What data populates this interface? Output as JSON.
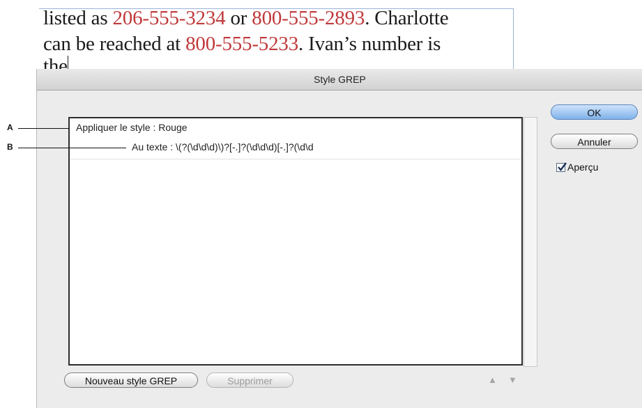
{
  "document": {
    "line1_a": "listed as ",
    "line1_phone1": "206-555-3234",
    "line1_b": " or ",
    "line1_phone2": "800-555-2893",
    "line1_c": ". Charlotte",
    "line2_a": "can be reached at ",
    "line2_phone": "800-555-5233",
    "line2_b": ". Ivan’s number is",
    "line3": "the"
  },
  "dialog": {
    "title": "Style GREP",
    "rule": {
      "apply_style": "Appliquer le style : Rouge",
      "to_text": "Au texte : \\(?(\\d\\d\\d)\\)?[-.]?(\\d\\d\\d)[-.]?(\\d\\d"
    },
    "buttons": {
      "ok": "OK",
      "cancel": "Annuler",
      "new_grep_style": "Nouveau style GREP",
      "delete": "Supprimer"
    },
    "preview": {
      "label": "Aperçu",
      "checked": true
    }
  },
  "callouts": {
    "a": "A",
    "b": "B"
  },
  "colors": {
    "phone_red": "#c0393b",
    "ok_blue": "#7fb2ea"
  }
}
